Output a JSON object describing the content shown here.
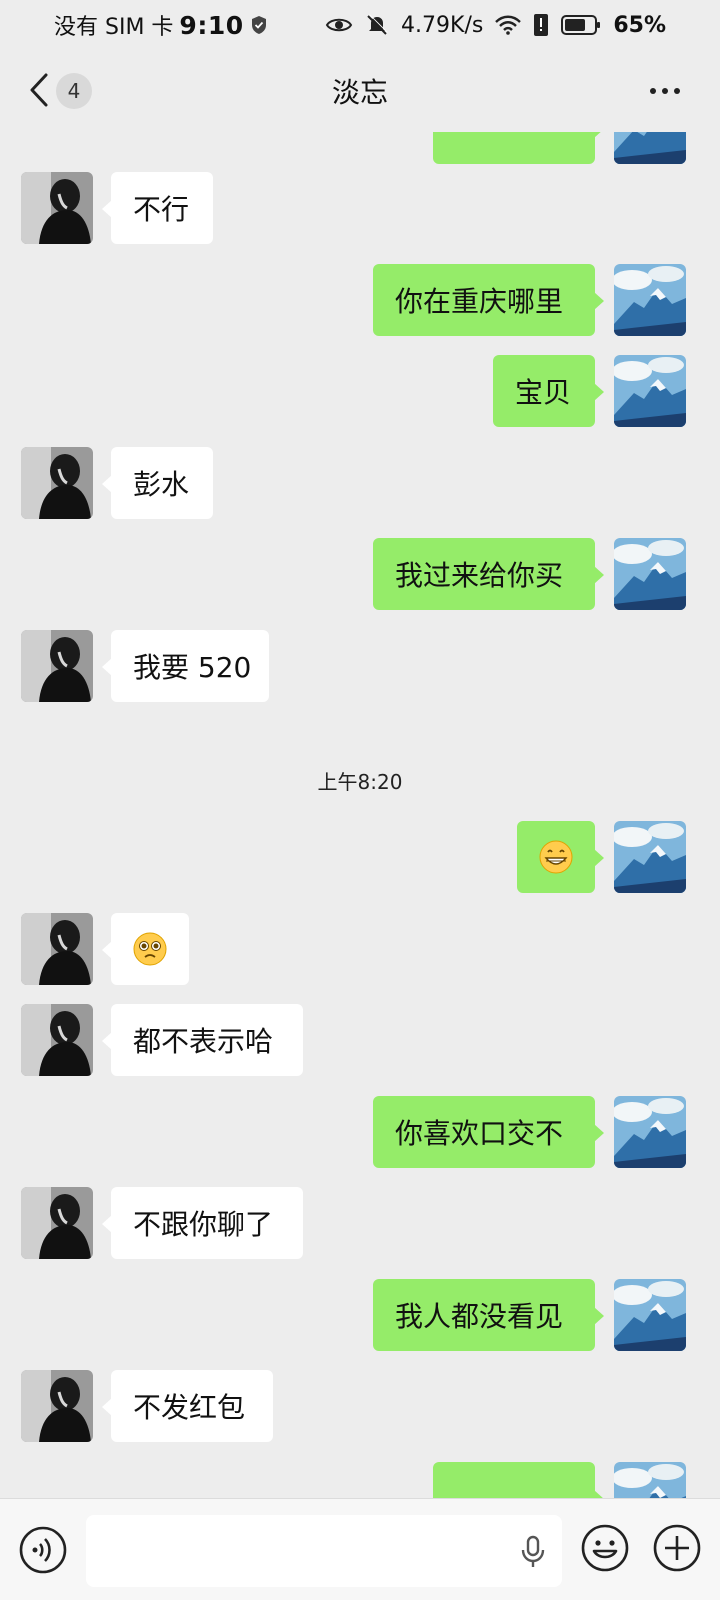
{
  "status_bar": {
    "carrier": "没有 SIM 卡",
    "time": "9:10",
    "network_speed": "4.79K/s",
    "battery": "65%",
    "icons": [
      "shield-icon",
      "eye-icon",
      "mute-bell-icon",
      "wifi-icon",
      "sim-alert-icon",
      "battery-icon"
    ]
  },
  "nav": {
    "back_icon": "chevron-left-icon",
    "unread_count": "4",
    "title": "淡忘",
    "more_icon": "more-dots-icon"
  },
  "messages": [
    {
      "side": "out",
      "type": "text",
      "text": "",
      "partial": true
    },
    {
      "side": "in",
      "type": "text",
      "text": "不行"
    },
    {
      "side": "out",
      "type": "text",
      "text": "你在重庆哪里"
    },
    {
      "side": "out",
      "type": "text",
      "text": "宝贝"
    },
    {
      "side": "in",
      "type": "text",
      "text": "彭水"
    },
    {
      "side": "out",
      "type": "text",
      "text": "我过来给你买"
    },
    {
      "side": "in",
      "type": "text",
      "text": "我要 520"
    },
    {
      "type": "timestamp",
      "text": "上午8:20"
    },
    {
      "side": "out",
      "type": "emoji",
      "emoji": "grin-emoji"
    },
    {
      "side": "in",
      "type": "emoji",
      "emoji": "pleading-emoji"
    },
    {
      "side": "in",
      "type": "text",
      "text": "都不表示哈"
    },
    {
      "side": "out",
      "type": "text",
      "text": "你喜欢口交不"
    },
    {
      "side": "in",
      "type": "text",
      "text": "不跟你聊了"
    },
    {
      "side": "out",
      "type": "text",
      "text": "我人都没看见"
    },
    {
      "side": "in",
      "type": "text",
      "text": "不发红包"
    },
    {
      "side": "out",
      "type": "text",
      "text": "",
      "partial": true
    }
  ],
  "input_bar": {
    "voice_icon": "voice-icon",
    "mic_icon": "mic-icon",
    "emoji_icon": "emoji-face-icon",
    "plus_icon": "plus-icon",
    "value": "",
    "placeholder": ""
  },
  "colors": {
    "chat_bg": "#ededed",
    "outgoing_bubble": "#95ec69",
    "incoming_bubble": "#ffffff",
    "input_bar_bg": "#f7f7f7"
  }
}
